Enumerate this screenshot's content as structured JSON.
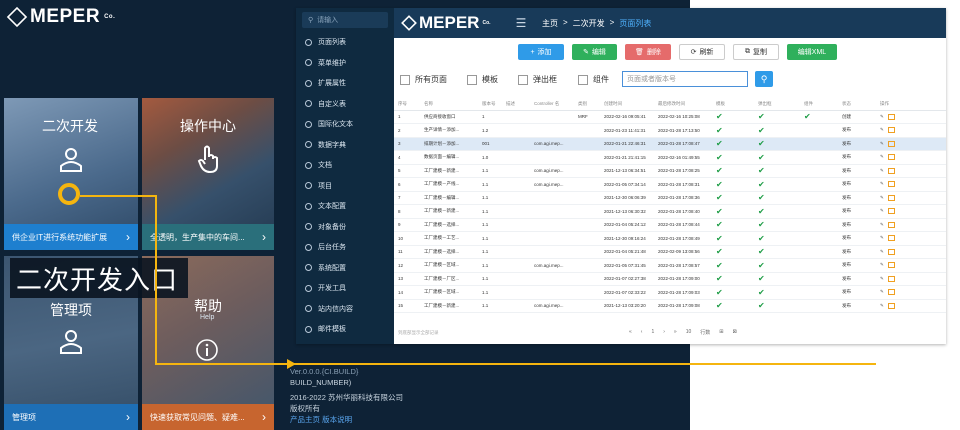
{
  "portal": {
    "brand": "MEPER",
    "brand_sub": "Co.",
    "big_label": "二次开发入口",
    "tiles": [
      {
        "title": "二次开发",
        "bar_text": "供企业IT进行系统功能扩展",
        "icon": "user-icon"
      },
      {
        "title": "操作中心",
        "bar_text": "全透明，生产集中的车间...",
        "icon": "hand-pointer-icon"
      },
      {
        "title": "管理项",
        "bar_text": "管理项",
        "icon": "user-icon"
      },
      {
        "title": "帮助",
        "subtitle": "Help",
        "bar_text": "快速获取常见问题、疑难...",
        "icon": "info-icon"
      }
    ],
    "footer": {
      "partial": "Ver.0.0.0.{CI.BUILD}",
      "build": "BUILD_NUMBER)",
      "copyright": "2016-2022 苏州华丽科技有限公司",
      "rights": "版权所有",
      "link1": "产品主页",
      "link2": "版本说明"
    }
  },
  "admin": {
    "brand": "MEPER",
    "brand_sub": "Co.",
    "search_placeholder": "请输入",
    "sidebar": [
      "页面列表",
      "菜单维护",
      "扩展属性",
      "自定义表",
      "国际化文本",
      "数据字典",
      "文档",
      "项目",
      "文本配置",
      "对象备份",
      "后台任务",
      "系统配置",
      "开发工具",
      "站内信内容",
      "邮件模板"
    ],
    "breadcrumb": [
      "主页",
      "二次开发",
      "页面列表"
    ],
    "buttons": {
      "add": "添加",
      "edit": "编辑",
      "delete": "删除",
      "refresh": "刷新",
      "copy": "复制",
      "edit_xml": "编辑XML"
    },
    "filters": {
      "all_pages": "所有页面",
      "template": "模板",
      "popup": "弹出框",
      "component": "组件",
      "search_placeholder": "页面或者版本号"
    },
    "table": {
      "headers": [
        "序号",
        "名称",
        "版本号",
        "描述",
        "Controller 名",
        "类别",
        "创建时间",
        "最后修改时间",
        "模板",
        "弹出框",
        "组件",
        "状态",
        "操作"
      ],
      "rows": [
        [
          "1",
          "供应商接收窗口",
          "1",
          "",
          "",
          "MRF",
          "2022-02-16 09:05:41",
          "2022-02-16 10:25:08",
          "✔",
          "✔",
          "✔",
          "创建",
          ""
        ],
        [
          "2",
          "生产详情－添加...",
          "1.2",
          "",
          "",
          "",
          "2022-01-23 11:41:31",
          "2022-01-28 17:13:50",
          "✔",
          "✔",
          "",
          "发布",
          ""
        ],
        [
          "3",
          "排期计划－添加...",
          "001",
          "",
          "com.agi.mep...",
          "",
          "2022-01-21 22:46:31",
          "2022-01-28 17:08:47",
          "✔",
          "✔",
          "",
          "发布",
          ""
        ],
        [
          "4",
          "数据页面－编辑...",
          "1.0",
          "",
          "",
          "",
          "2022-01-21 21:41:15",
          "2022-02-16 01:49:55",
          "✔",
          "✔",
          "",
          "发布",
          ""
        ],
        [
          "5",
          "工厂建模－新建...",
          "1.1",
          "",
          "com.agi.mep...",
          "",
          "2021-12-13 06:34:51",
          "2022-01-28 17:08:25",
          "✔",
          "✔",
          "",
          "发布",
          ""
        ],
        [
          "6",
          "工厂建模－产线...",
          "1.1",
          "",
          "com.agi.mep...",
          "",
          "2022-01-05 07:34:14",
          "2022-01-28 17:08:31",
          "✔",
          "✔",
          "",
          "发布",
          ""
        ],
        [
          "7",
          "工厂建模－编辑...",
          "1.1",
          "",
          "",
          "",
          "2021-12-30 06:06:39",
          "2022-01-28 17:08:36",
          "✔",
          "✔",
          "",
          "发布",
          ""
        ],
        [
          "8",
          "工厂建模－新建...",
          "1.1",
          "",
          "",
          "",
          "2021-12-13 06:30:32",
          "2022-01-28 17:08:40",
          "✔",
          "✔",
          "",
          "发布",
          ""
        ],
        [
          "9",
          "工厂建模－选择...",
          "1.1",
          "",
          "",
          "",
          "2022-01-04 05:24:12",
          "2022-01-28 17:08:44",
          "✔",
          "✔",
          "",
          "发布",
          ""
        ],
        [
          "10",
          "工厂建模－工艺...",
          "1.1",
          "",
          "",
          "",
          "2021-12-30 09:16:24",
          "2022-01-28 17:08:49",
          "✔",
          "✔",
          "",
          "发布",
          ""
        ],
        [
          "11",
          "工厂建模－选择...",
          "1.1",
          "",
          "",
          "",
          "2022-01-04 05:21:48",
          "2022-02-09 13:08:56",
          "✔",
          "✔",
          "",
          "发布",
          ""
        ],
        [
          "12",
          "工厂建模－区域...",
          "1.1",
          "",
          "com.agi.mep...",
          "",
          "2022-01-05 07:31:45",
          "2022-01-28 17:08:57",
          "✔",
          "✔",
          "",
          "发布",
          ""
        ],
        [
          "13",
          "工厂建模－厂区...",
          "1.1",
          "",
          "",
          "",
          "2022-01-07 02:27:38",
          "2022-01-28 17:09:00",
          "✔",
          "✔",
          "",
          "发布",
          ""
        ],
        [
          "14",
          "工厂建模－区域...",
          "1.1",
          "",
          "",
          "",
          "2022-01-07 02:33:22",
          "2022-01-28 17:09:03",
          "✔",
          "✔",
          "",
          "发布",
          ""
        ],
        [
          "15",
          "工厂建模－新建...",
          "1.1",
          "",
          "com.agi.mep...",
          "",
          "2021-12-13 03:20:20",
          "2022-01-28 17:09:08",
          "✔",
          "✔",
          "",
          "发布",
          ""
        ]
      ],
      "total_text": "到底部显示全部记录",
      "pager": [
        "«",
        "‹",
        "1",
        "›",
        "»",
        "10",
        "行数",
        "⊞",
        "⊠"
      ]
    }
  },
  "colors": {
    "accent": "#f5b50f",
    "brand_blue": "#183a59",
    "success": "#1e9d46"
  }
}
